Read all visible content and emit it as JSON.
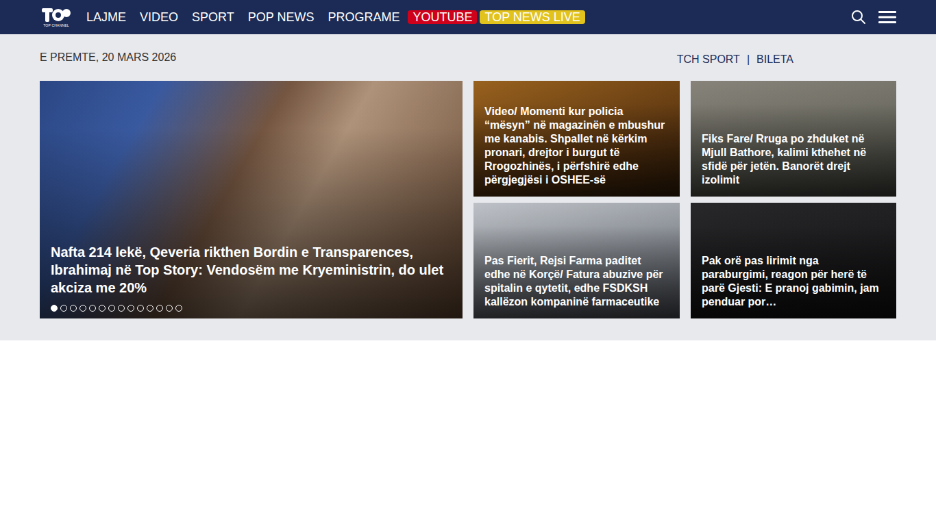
{
  "logo": {
    "text": "TOP CHANNEL"
  },
  "nav": [
    {
      "label": "LAJME",
      "kind": "plain",
      "color": ""
    },
    {
      "label": "VIDEO",
      "kind": "plain",
      "color": ""
    },
    {
      "label": "SPORT",
      "kind": "plain",
      "color": ""
    },
    {
      "label": "POP NEWS",
      "kind": "plain",
      "color": ""
    },
    {
      "label": "PROGRAME",
      "kind": "plain",
      "color": ""
    },
    {
      "label": "YOUTUBE",
      "kind": "badge",
      "color": "#d0021b"
    },
    {
      "label": "TOP NEWS LIVE",
      "kind": "badge",
      "color": "#e2c21d"
    }
  ],
  "date": "E PREMTE, 20 MARS 2026",
  "top_links": [
    "TCH SPORT",
    "|",
    "BILETA"
  ],
  "main_story": {
    "title": "Nafta 214 lekë, Qeveria rikthen Bordin e Transparences, Ibrahimaj në Top Story: Vendosëm me Kryeministrin, do ulet akciza me 20%"
  },
  "slider_dots": [
    {
      "selected": true
    },
    {
      "selected": false
    },
    {
      "selected": false
    },
    {
      "selected": false
    },
    {
      "selected": false
    },
    {
      "selected": false
    },
    {
      "selected": false
    },
    {
      "selected": false
    },
    {
      "selected": false
    },
    {
      "selected": false
    },
    {
      "selected": false
    },
    {
      "selected": false
    },
    {
      "selected": false
    },
    {
      "selected": false
    }
  ],
  "stories": [
    {
      "title": "Video/ Momenti kur policia “mësyn” në magazinën e mbushur me kanabis. Shpallet në kërkim pronari, drejtor i burgut të Rrogozhinës, i përfshirë edhe përgjegjësi i OSHEE-së"
    },
    {
      "title": "Fiks Fare/ Rruga po zhduket në Mjull Bathore, kalimi kthehet në sfidë për jetën. Banorët drejt izolimit"
    },
    {
      "title": "Pas Fierit, Rejsi Farma paditet edhe në Korçë/ Fatura abuzive për spitalin e qytetit, edhe FSDKSH kallëzon kompaninë farmaceutike"
    },
    {
      "title": "Pak orë pas lirimit nga paraburgimi, reagon për herë të parë Gjesti: E pranoj gabimin, jam penduar por…"
    }
  ]
}
